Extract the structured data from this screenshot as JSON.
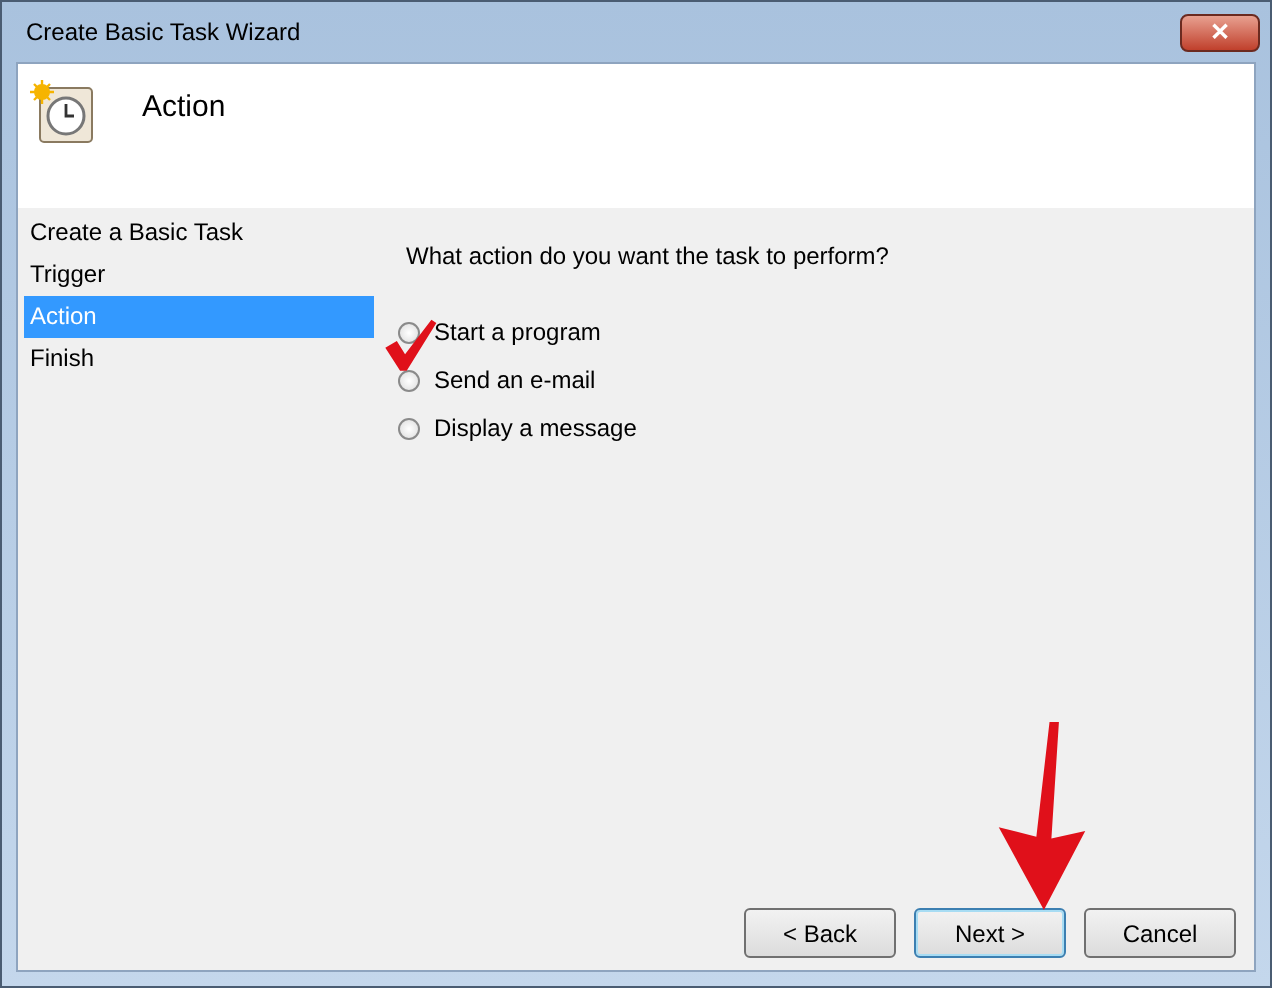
{
  "window": {
    "title": "Create Basic Task Wizard",
    "close_label": "✕"
  },
  "header": {
    "title": "Action"
  },
  "steps": [
    {
      "label": "Create a Basic Task",
      "selected": false
    },
    {
      "label": "Trigger",
      "selected": false
    },
    {
      "label": "Action",
      "selected": true
    },
    {
      "label": "Finish",
      "selected": false
    }
  ],
  "question": "What action do you want the task to perform?",
  "options": [
    {
      "label": "Start a program",
      "selected": false
    },
    {
      "label": "Send an e-mail",
      "selected": false
    },
    {
      "label": "Display a message",
      "selected": false
    }
  ],
  "buttons": [
    {
      "label": "< Back",
      "default": false
    },
    {
      "label": "Next >",
      "default": true
    },
    {
      "label": "Cancel",
      "default": false
    }
  ]
}
